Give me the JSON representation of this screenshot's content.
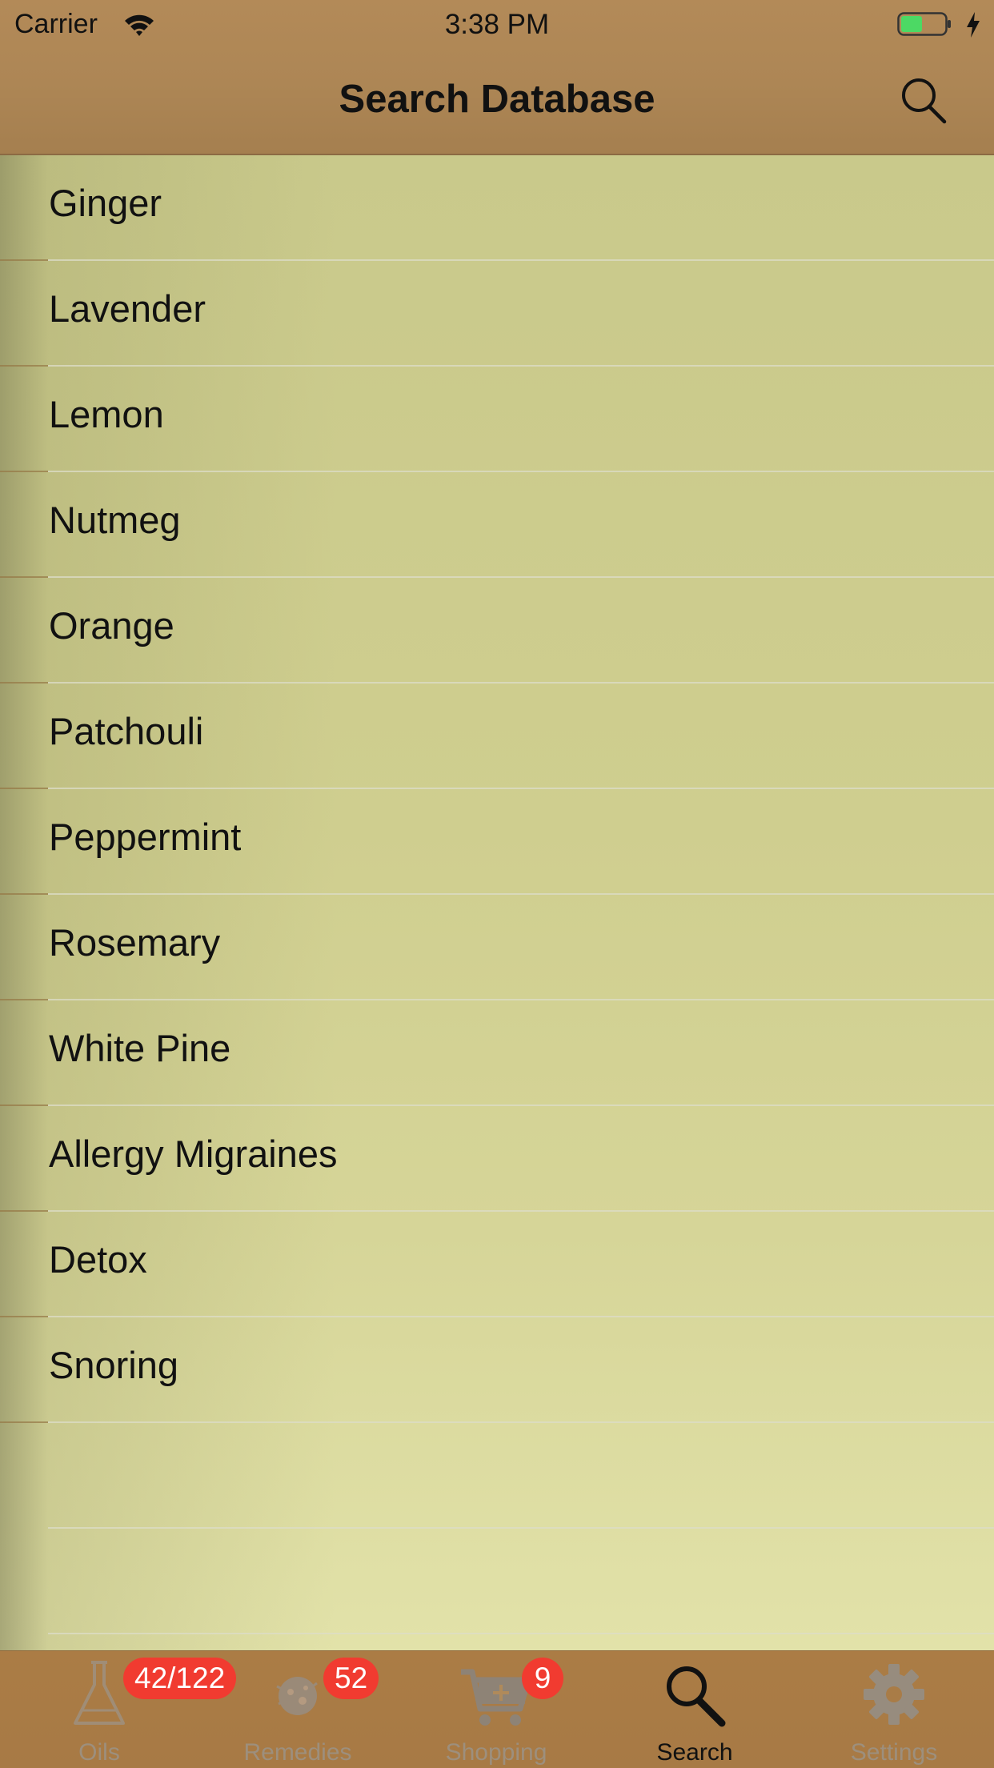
{
  "status_bar": {
    "carrier": "Carrier",
    "time": "3:38 PM",
    "battery_color": "#4cd964"
  },
  "nav": {
    "title": "Search Database",
    "search_icon": "search-icon"
  },
  "list": {
    "items": [
      {
        "label": "Ginger"
      },
      {
        "label": "Lavender"
      },
      {
        "label": "Lemon"
      },
      {
        "label": "Nutmeg"
      },
      {
        "label": "Orange"
      },
      {
        "label": "Patchouli"
      },
      {
        "label": "Peppermint"
      },
      {
        "label": "Rosemary"
      },
      {
        "label": "White Pine"
      },
      {
        "label": "Allergy Migraines"
      },
      {
        "label": "Detox"
      },
      {
        "label": "Snoring"
      }
    ]
  },
  "tabbar": {
    "tabs": [
      {
        "label": "Oils",
        "badge": "42/122",
        "icon": "flask-icon",
        "active": false
      },
      {
        "label": "Remedies",
        "badge": "52",
        "icon": "remedies-icon",
        "active": false
      },
      {
        "label": "Shopping",
        "badge": "9",
        "icon": "cart-icon",
        "active": false
      },
      {
        "label": "Search",
        "badge": "",
        "icon": "search-icon",
        "active": true
      },
      {
        "label": "Settings",
        "badge": "",
        "icon": "gear-icon",
        "active": false
      }
    ],
    "badge_color": "#f13b30"
  }
}
